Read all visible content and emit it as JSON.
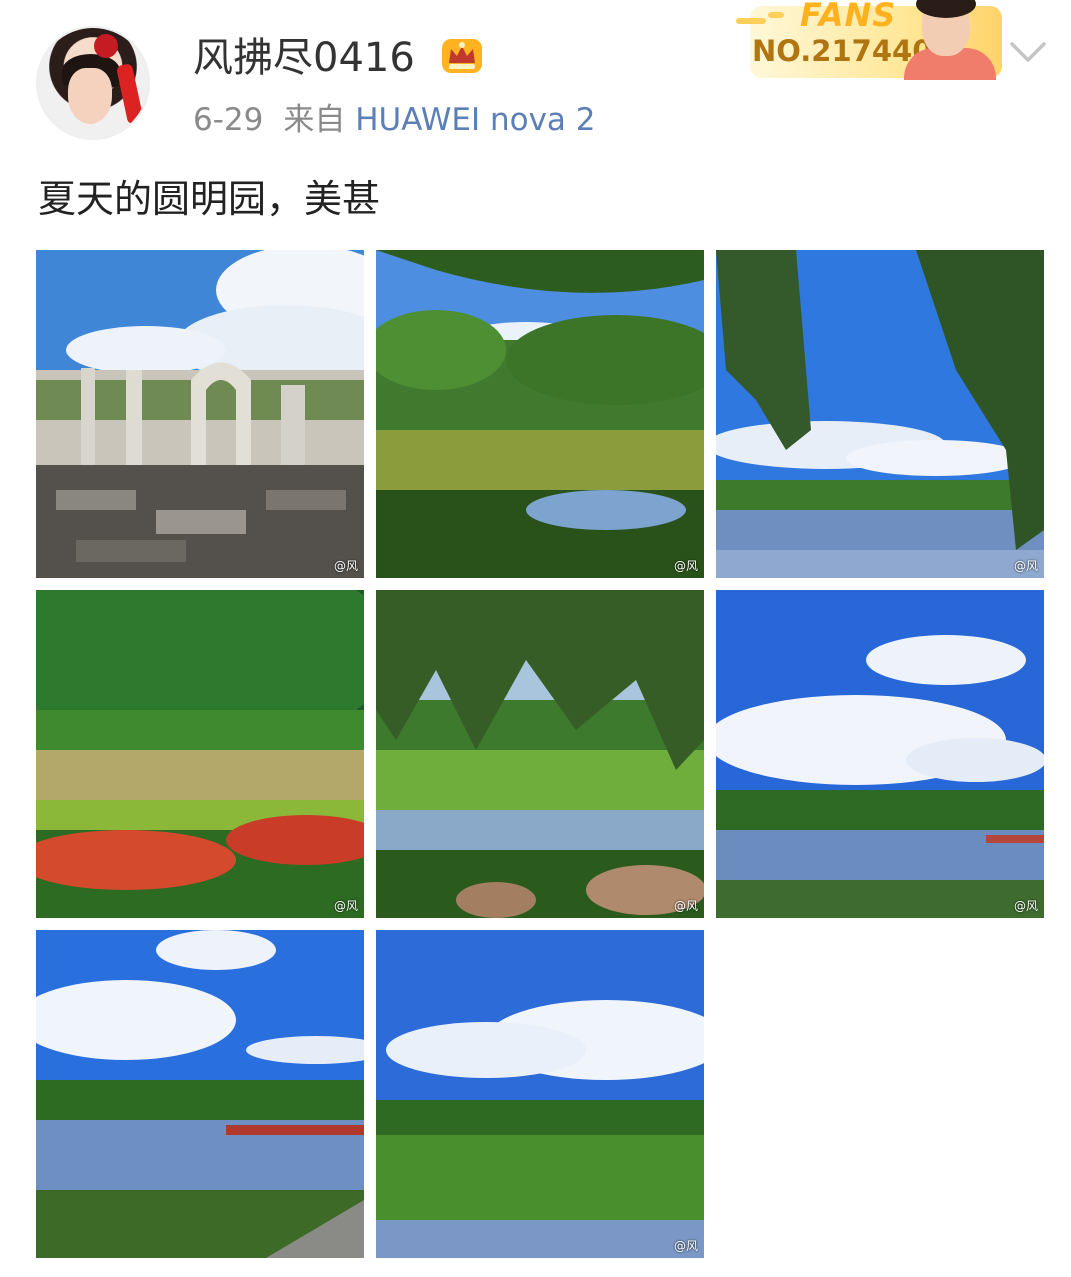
{
  "user": {
    "name": "风拂尽0416",
    "date": "6-29",
    "from_label": "来自",
    "device": "HUAWEI nova 2"
  },
  "fans_badge": {
    "label": "FANS",
    "number": "NO.217440"
  },
  "post": {
    "text": "夏天的圆明园，美甚"
  },
  "photos": [
    {
      "subject": "ruins",
      "watermark": "@风"
    },
    {
      "subject": "pond-trees",
      "watermark": "@风"
    },
    {
      "subject": "willow-lake",
      "watermark": "@风"
    },
    {
      "subject": "garden-flowers",
      "watermark": "@风"
    },
    {
      "subject": "willow-lotus",
      "watermark": "@风"
    },
    {
      "subject": "lake-clouds",
      "watermark": "@风"
    },
    {
      "subject": "lake-bridge",
      "watermark": ""
    },
    {
      "subject": "lotus-field",
      "watermark": "@风"
    }
  ],
  "icons": {
    "crown": "crown-vip-icon",
    "chevron": "chevron-down-icon"
  },
  "colors": {
    "link": "#5b7fb6",
    "meta": "#8a8a8a",
    "fans_gold": "#ffb21e"
  }
}
